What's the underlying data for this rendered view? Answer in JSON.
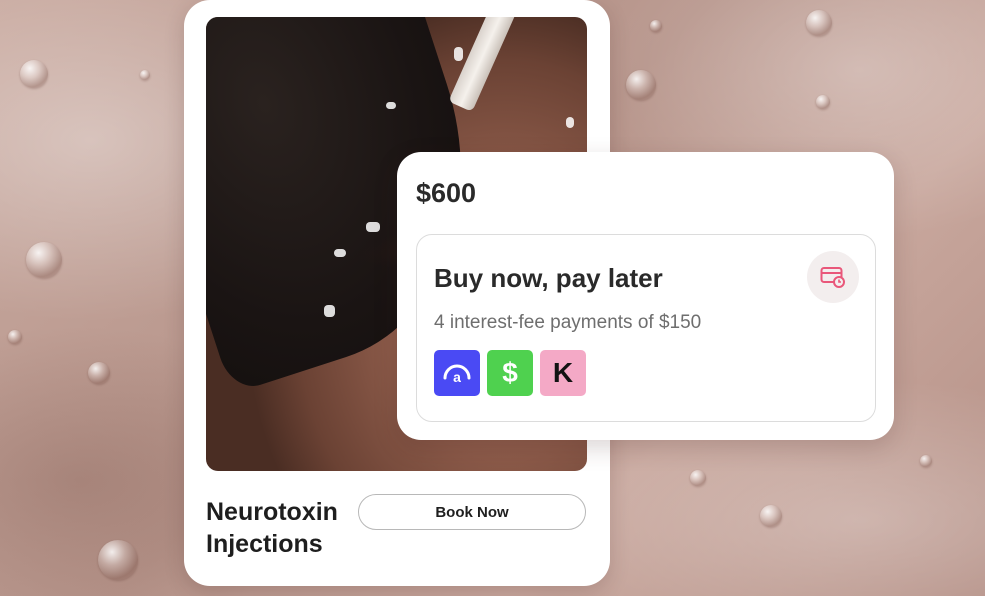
{
  "product": {
    "name": "Neurotoxin Injections",
    "book_button_label": "Book Now"
  },
  "payment": {
    "price": "$600",
    "bnpl_title": "Buy now, pay later",
    "bnpl_subtitle": "4 interest-fee payments of $150",
    "providers": [
      {
        "name": "Affirm",
        "glyph": "a",
        "color": "#4a4af4"
      },
      {
        "name": "Cash App",
        "glyph": "$",
        "color": "#4fd14f"
      },
      {
        "name": "Klarna",
        "glyph": "K",
        "color": "#f4a9c6"
      }
    ]
  },
  "icons": {
    "bnpl_icon": "credit-card-clock-icon",
    "accent_color": "#e9577a"
  }
}
